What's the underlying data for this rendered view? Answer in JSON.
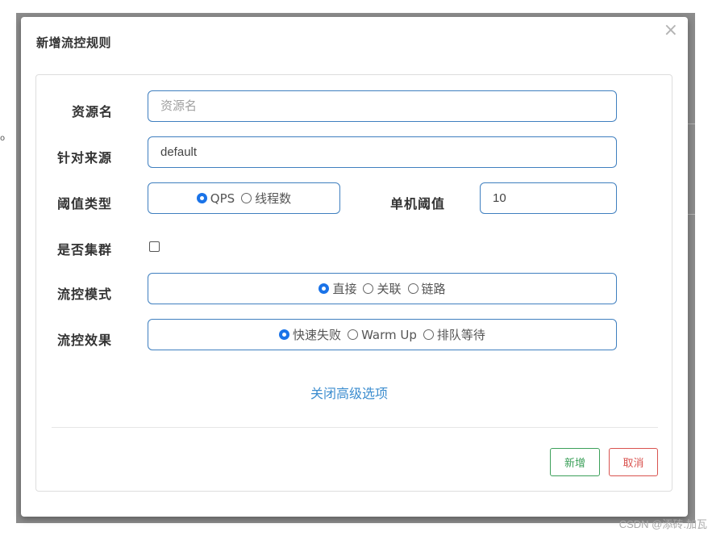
{
  "dialog": {
    "title": "新增流控规则",
    "close_glyph": "×"
  },
  "form": {
    "resource": {
      "label": "资源名",
      "placeholder": "资源名",
      "value": ""
    },
    "source": {
      "label": "针对来源",
      "value": "default"
    },
    "threshold_type": {
      "label": "阈值类型",
      "options": [
        "QPS",
        "线程数"
      ],
      "selected": "QPS"
    },
    "single_threshold": {
      "label": "单机阈值",
      "value": "10"
    },
    "cluster": {
      "label": "是否集群",
      "checked": false
    },
    "flow_mode": {
      "label": "流控模式",
      "options": [
        "直接",
        "关联",
        "链路"
      ],
      "selected": "直接"
    },
    "flow_effect": {
      "label": "流控效果",
      "options": [
        "快速失败",
        "Warm Up",
        "排队等待"
      ],
      "selected": "快速失败"
    },
    "advanced_toggle": "关闭高级选项"
  },
  "actions": {
    "add": "新增",
    "cancel": "取消"
  },
  "background": {
    "fragment": "o"
  },
  "watermark": "CSDN @添砖.加瓦",
  "colors": {
    "accent_blue": "#3f7fbf",
    "link_blue": "#3c8dcf",
    "add_green": "#3ca05a",
    "cancel_red": "#d9534f"
  }
}
